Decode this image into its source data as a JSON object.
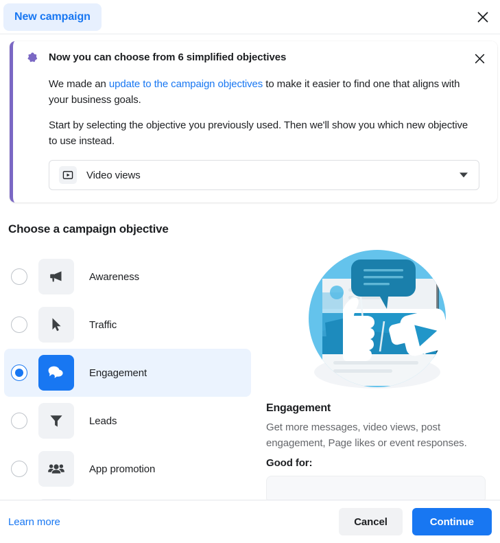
{
  "header": {
    "tab_label": "New campaign",
    "close_icon": "close-icon"
  },
  "banner": {
    "icon": "star-icon",
    "title": "Now you can choose from 6 simplified objectives",
    "close_icon": "close-icon",
    "paragraph1_before": "We made an ",
    "paragraph1_link": "update to the campaign objectives",
    "paragraph1_after": " to make it easier to find one that aligns with your business goals.",
    "paragraph2": "Start by selecting the objective you previously used. Then we'll show you which new objective to use instead.",
    "accent_color": "#7b68c4",
    "dropdown": {
      "icon": "video-views-icon",
      "value": "Video views",
      "caret_icon": "chevron-down-icon"
    }
  },
  "objectives": {
    "section_title": "Choose a campaign objective",
    "selected": "Engagement",
    "items": [
      {
        "label": "Awareness",
        "icon": "megaphone-icon",
        "selected": false
      },
      {
        "label": "Traffic",
        "icon": "cursor-arrow-icon",
        "selected": false
      },
      {
        "label": "Engagement",
        "icon": "chat-bubbles-icon",
        "selected": true
      },
      {
        "label": "Leads",
        "icon": "funnel-icon",
        "selected": false
      },
      {
        "label": "App promotion",
        "icon": "people-group-icon",
        "selected": false
      }
    ]
  },
  "detail": {
    "illustration": "engagement-illustration",
    "title": "Engagement",
    "description": "Get more messages, video views, post engagement, Page likes or event responses.",
    "good_for_label": "Good for:"
  },
  "footer": {
    "learn_more": "Learn more",
    "cancel_label": "Cancel",
    "continue_label": "Continue"
  },
  "colors": {
    "brand_blue": "#1877f2",
    "banner_purple": "#7b68c4",
    "selected_row_bg": "#ebf3fe"
  }
}
